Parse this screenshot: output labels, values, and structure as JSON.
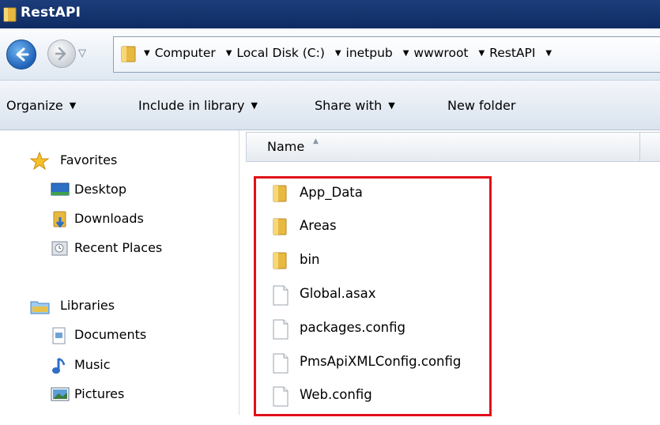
{
  "window": {
    "title": "RestAPI"
  },
  "address": {
    "crumbs": [
      "Computer",
      "Local Disk (C:)",
      "inetpub",
      "wwwroot",
      "RestAPI"
    ]
  },
  "toolbar": {
    "organize": "Organize",
    "include_in_library": "Include in library",
    "share_with": "Share with",
    "new_folder": "New folder"
  },
  "nav": {
    "favorites": "Favorites",
    "desktop": "Desktop",
    "downloads": "Downloads",
    "recent_places": "Recent Places",
    "libraries": "Libraries",
    "documents": "Documents",
    "music": "Music",
    "pictures": "Pictures"
  },
  "columns": {
    "name": "Name"
  },
  "files": [
    {
      "name": "App_Data",
      "icon": "folder-icon"
    },
    {
      "name": "Areas",
      "icon": "folder-icon"
    },
    {
      "name": "bin",
      "icon": "folder-icon"
    },
    {
      "name": "Global.asax",
      "icon": "file-icon"
    },
    {
      "name": "packages.config",
      "icon": "file-icon"
    },
    {
      "name": "PmsApiXMLConfig.config",
      "icon": "file-icon"
    },
    {
      "name": "Web.config",
      "icon": "file-icon"
    }
  ],
  "colors": {
    "highlight": "#e0101a",
    "titlebar": "#1b3d7a",
    "folder": "#e8b93f"
  }
}
